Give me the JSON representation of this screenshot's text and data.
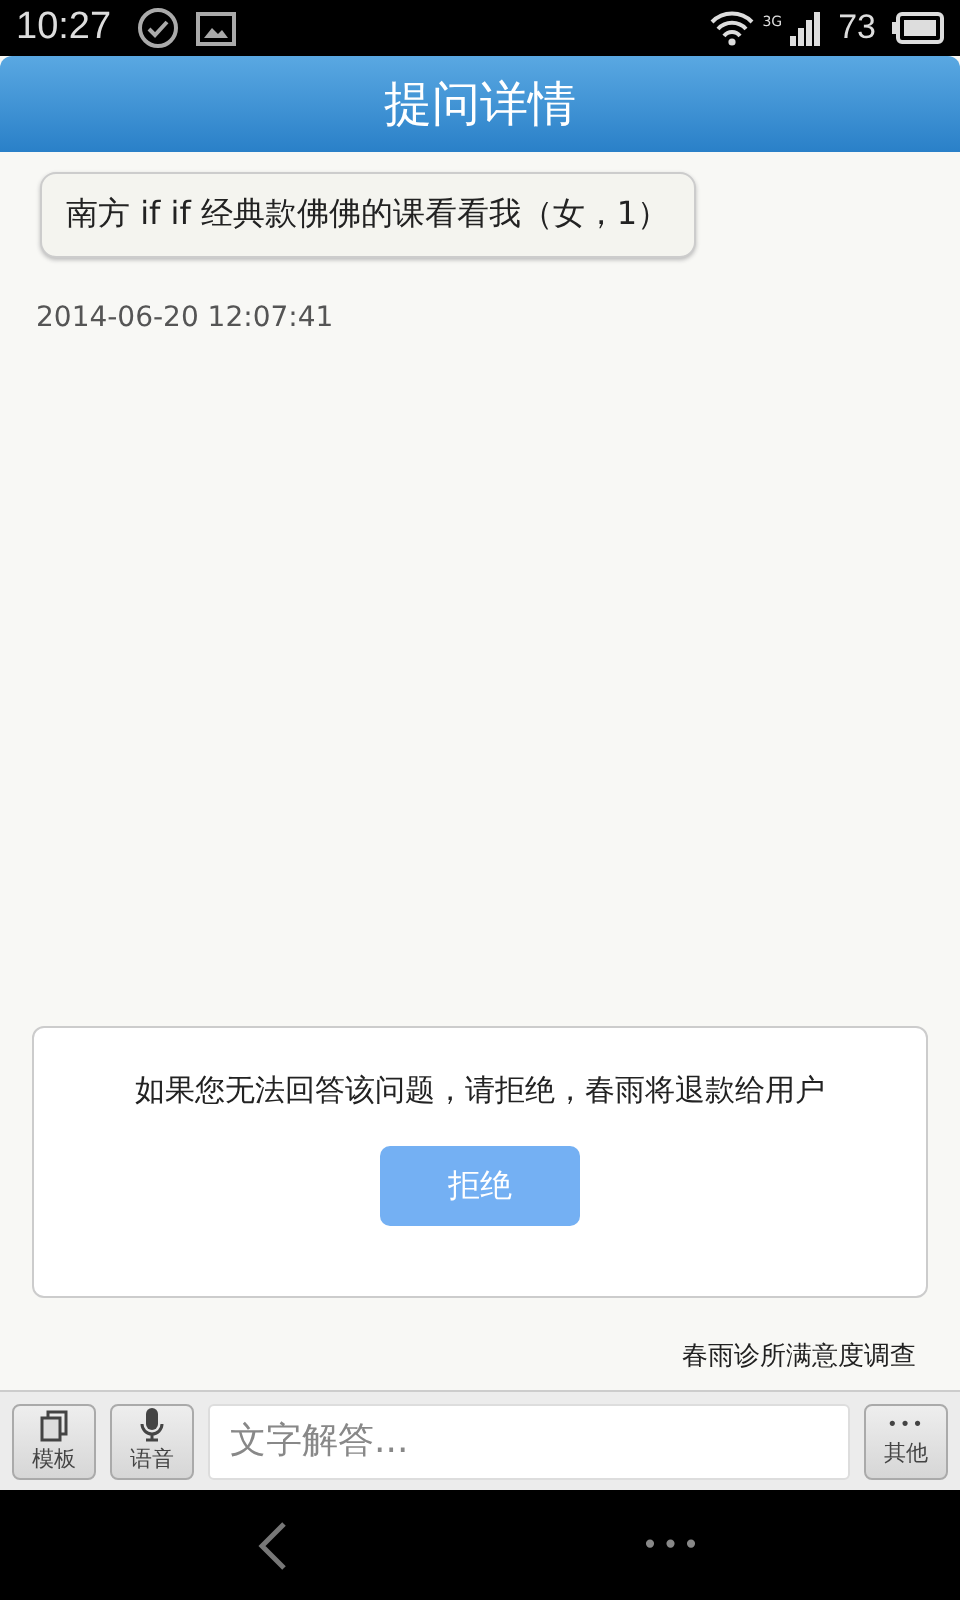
{
  "status_bar": {
    "time": "10:27",
    "network": "3G",
    "battery": "73"
  },
  "header": {
    "title": "提问详情"
  },
  "question": {
    "text": "南方 if if 经典款佛佛的课看看我（女，1）",
    "time": "2014-06-20 12:07:41"
  },
  "notice": {
    "text": "如果您无法回答该问题，请拒绝，春雨将退款给用户",
    "button": "拒绝"
  },
  "survey_link": "春雨诊所满意度调查",
  "toolbar": {
    "template": "模板",
    "voice": "语音",
    "input": {
      "placeholder": "文字解答..."
    },
    "more_dots": "•••",
    "more": "其他"
  },
  "nav": {
    "menu": "•••"
  }
}
